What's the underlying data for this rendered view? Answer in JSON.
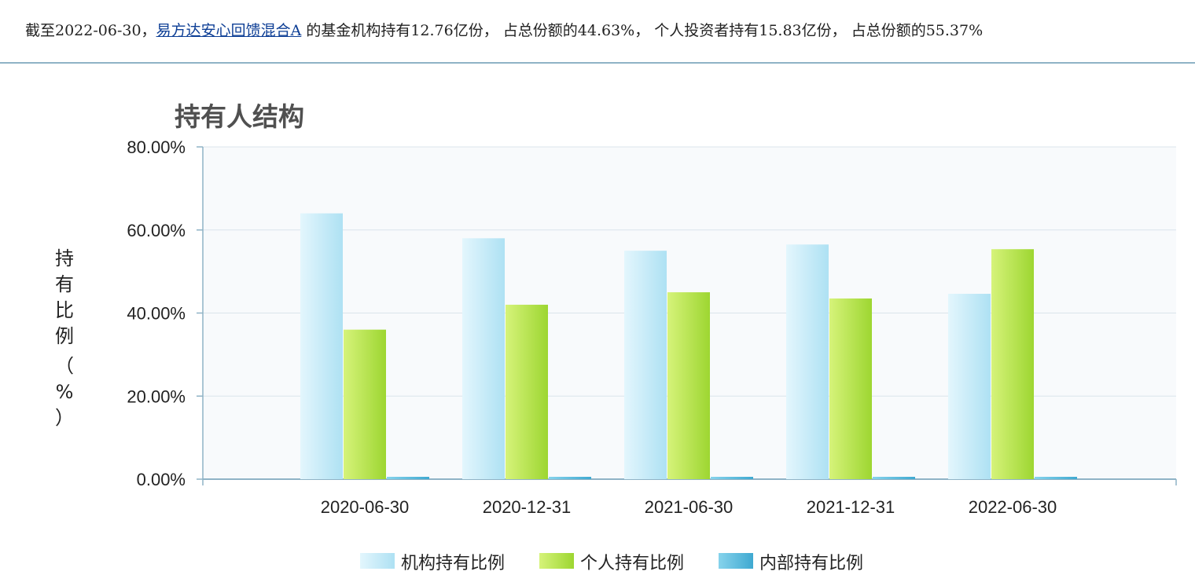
{
  "summary": {
    "prefix": "截至2022-06-30，",
    "fund_link": "易方达安心回馈混合A",
    "suffix": " 的基金机构持有12.76亿份， 占总份额的44.63%， 个人投资者持有15.83亿份， 占总份额的55.37%"
  },
  "chart_data": {
    "type": "bar",
    "title": "持有人结构",
    "ylabel": "持有比例（%）",
    "ylim": [
      0,
      80
    ],
    "y_ticks": [
      0,
      20,
      40,
      60,
      80
    ],
    "y_tick_labels": [
      "0.00%",
      "20.00%",
      "40.00%",
      "60.00%",
      "80.00%"
    ],
    "categories": [
      "2020-06-30",
      "2020-12-31",
      "2021-06-30",
      "2021-12-31",
      "2022-06-30"
    ],
    "series": [
      {
        "name": "机构持有比例",
        "values": [
          64.0,
          58.0,
          55.0,
          56.5,
          44.63
        ],
        "color": "#bfe9f7"
      },
      {
        "name": "个人持有比例",
        "values": [
          36.0,
          42.0,
          45.0,
          43.5,
          55.37
        ],
        "color": "#b3e044"
      },
      {
        "name": "内部持有比例",
        "values": [
          0.5,
          0.5,
          0.5,
          0.5,
          0.5
        ],
        "color": "#5bbfe0"
      }
    ],
    "grid": true,
    "legend_position": "bottom"
  }
}
